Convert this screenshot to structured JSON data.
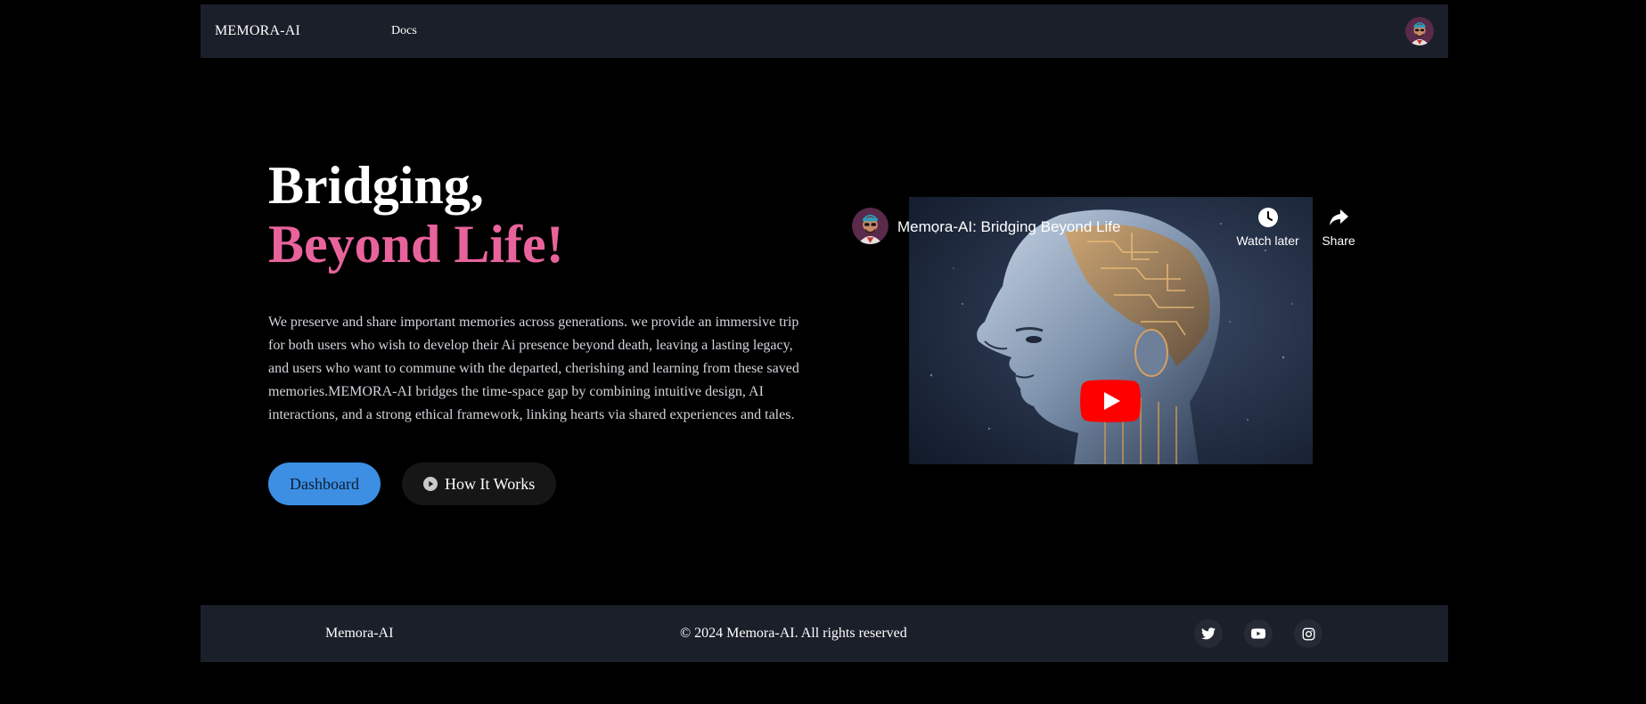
{
  "navbar": {
    "brand": "MEMORA-AI",
    "links": [
      {
        "label": "Docs"
      }
    ],
    "avatar_icon": "user-avatar"
  },
  "hero": {
    "title_line1": "Bridging,",
    "title_line2": "Beyond Life!",
    "title_accent_color": "#e8639c",
    "description": "We preserve and share important memories across generations. we provide an immersive trip for both users who wish to develop their Ai presence beyond death, leaving a lasting legacy, and users who want to commune with the departed, cherishing and learning from these saved memories.MEMORA-AI bridges the time-space gap by combining intuitive design, AI interactions, and a strong ethical framework, linking hearts via shared experiences and tales.",
    "buttons": {
      "dashboard": "Dashboard",
      "how_it_works": "How It Works"
    },
    "dashboard_color": "#3c8fe3"
  },
  "video": {
    "title": "Memora-AI: Bridging Beyond Life",
    "watch_later": "Watch later",
    "share": "Share",
    "thumbnail": "ai-robot-head-thumbnail",
    "play_button_color": "#ff0000"
  },
  "footer": {
    "brand": "Memora-AI",
    "copyright": "© 2024 Memora-AI. All rights reserved",
    "social": [
      {
        "icon": "twitter-icon"
      },
      {
        "icon": "youtube-icon"
      },
      {
        "icon": "instagram-icon"
      }
    ]
  }
}
